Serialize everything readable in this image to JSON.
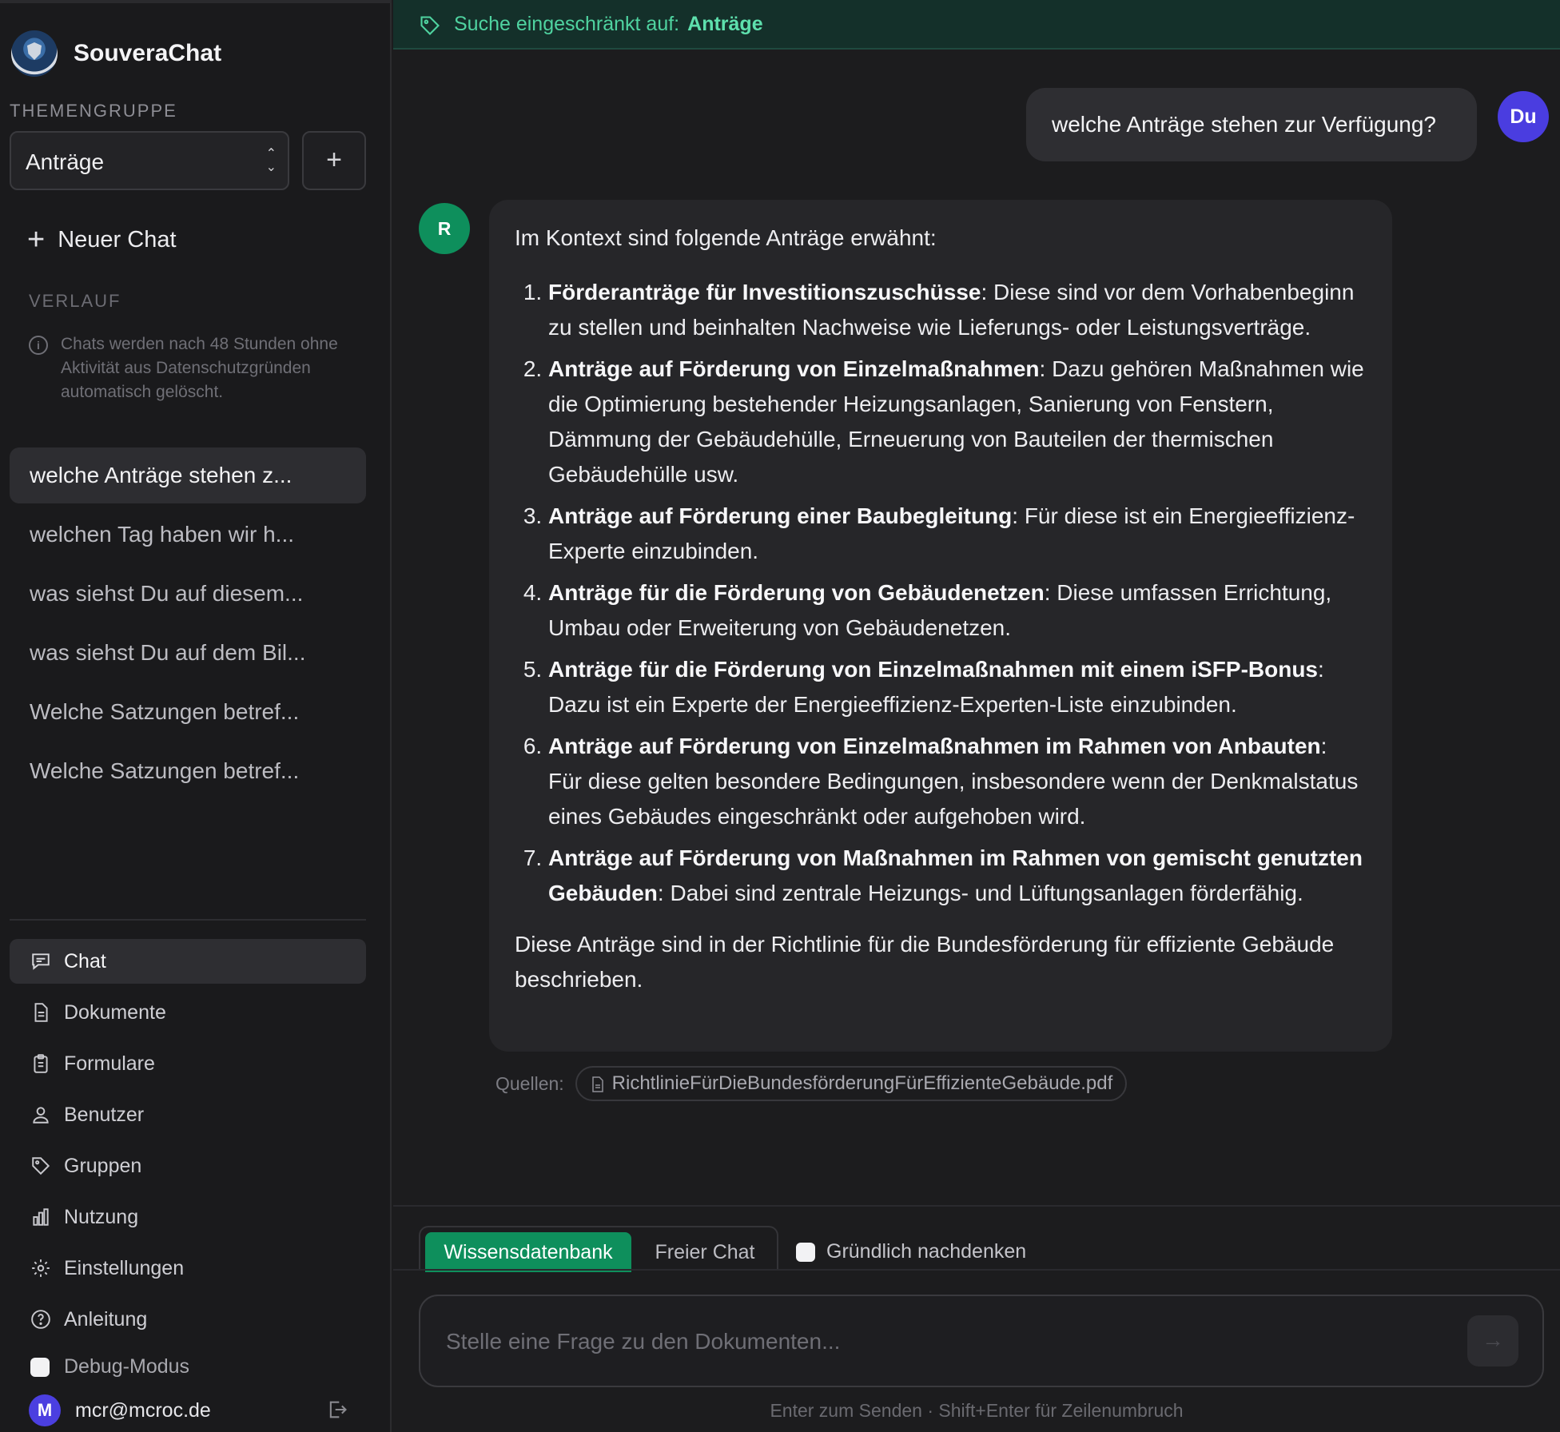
{
  "app": {
    "title": "SouveraChat"
  },
  "sidebar": {
    "theme_group_label": "THEMENGRUPPE",
    "theme_group_selected": "Anträge",
    "add_group_label": "+",
    "new_chat_label": "Neuer Chat",
    "history_label": "VERLAUF",
    "history_note": "Chats werden nach 48 Stunden ohne Aktivität aus Datenschutzgründen automatisch gelöscht.",
    "history": [
      {
        "title": "welche Anträge stehen z...",
        "active": true
      },
      {
        "title": "welchen Tag haben wir h...",
        "active": false
      },
      {
        "title": "was siehst Du auf diesem...",
        "active": false
      },
      {
        "title": "was siehst Du auf dem Bil...",
        "active": false
      },
      {
        "title": "Welche Satzungen betref...",
        "active": false
      },
      {
        "title": "Welche Satzungen betref...",
        "active": false
      }
    ],
    "nav": [
      {
        "label": "Chat",
        "icon": "chat-icon",
        "active": true
      },
      {
        "label": "Dokumente",
        "icon": "document-icon",
        "active": false
      },
      {
        "label": "Formulare",
        "icon": "clipboard-icon",
        "active": false
      },
      {
        "label": "Benutzer",
        "icon": "users-icon",
        "active": false
      },
      {
        "label": "Gruppen",
        "icon": "tag-icon",
        "active": false
      },
      {
        "label": "Nutzung",
        "icon": "bar-chart-icon",
        "active": false
      },
      {
        "label": "Einstellungen",
        "icon": "gear-icon",
        "active": false
      },
      {
        "label": "Anleitung",
        "icon": "help-circle-icon",
        "active": false
      }
    ],
    "debug_label": "Debug-Modus",
    "user": {
      "initial": "M",
      "email": "mcr@mcroc.de"
    }
  },
  "main": {
    "filter_prefix": "Suche eingeschränkt auf:",
    "filter_value": "Anträge",
    "user_message": "welche Anträge stehen zur Verfügung?",
    "user_avatar": "Du",
    "assistant_avatar": "R",
    "answer": {
      "intro": "Im Kontext sind folgende Anträge erwähnt:",
      "items": [
        {
          "bold": "Förderanträge für Investitionszuschüsse",
          "text": ": Diese sind vor dem Vorhabenbeginn zu stellen und beinhalten Nachweise wie Lieferungs- oder Leistungsverträge."
        },
        {
          "bold": "Anträge auf Förderung von Einzelmaßnahmen",
          "text": ": Dazu gehören Maßnahmen wie die Optimierung bestehender Heizungsanlagen, Sanierung von Fenstern, Dämmung der Gebäudehülle, Erneuerung von Bauteilen der thermischen Gebäudehülle usw."
        },
        {
          "bold": "Anträge auf Förderung einer Baubegleitung",
          "text": ": Für diese ist ein Energieeffizienz-Experte einzubinden."
        },
        {
          "bold": "Anträge für die Förderung von Gebäudenetzen",
          "text": ": Diese umfassen Errichtung, Umbau oder Erweiterung von Gebäudenetzen."
        },
        {
          "bold": "Anträge für die Förderung von Einzelmaßnahmen mit einem iSFP-Bonus",
          "text": ": Dazu ist ein Experte der Energieeffizienz-Experten-Liste einzubinden."
        },
        {
          "bold": "Anträge auf Förderung von Einzelmaßnahmen im Rahmen von Anbauten",
          "text": ": Für diese gelten besondere Bedingungen, insbesondere wenn der Denkmalstatus eines Gebäudes eingeschränkt oder aufgehoben wird."
        },
        {
          "bold": "Anträge auf Förderung von Maßnahmen im Rahmen von gemischt genutzten Gebäuden",
          "text": ": Dabei sind zentrale Heizungs- und Lüftungsanlagen förderfähig."
        }
      ],
      "outro": "Diese Anträge sind in der Richtlinie für die Bundesförderung für effiziente Gebäude beschrieben."
    },
    "sources_label": "Quellen:",
    "source_file": "RichtlinieFürDieBundesförderungFürEffizienteGebäude.pdf",
    "tabs": {
      "knowledge": "Wissensdatenbank",
      "free": "Freier Chat"
    },
    "deep_think_label": "Gründlich nachdenken",
    "input_placeholder": "Stelle eine Frage zu den Dokumenten...",
    "send_label": "→",
    "hint": "Enter zum Senden · Shift+Enter für Zeilenumbruch"
  },
  "colors": {
    "accent_green": "#0e8f5c",
    "avatar_purple": "#4a3de0",
    "filter_text": "#4fd3a0"
  }
}
